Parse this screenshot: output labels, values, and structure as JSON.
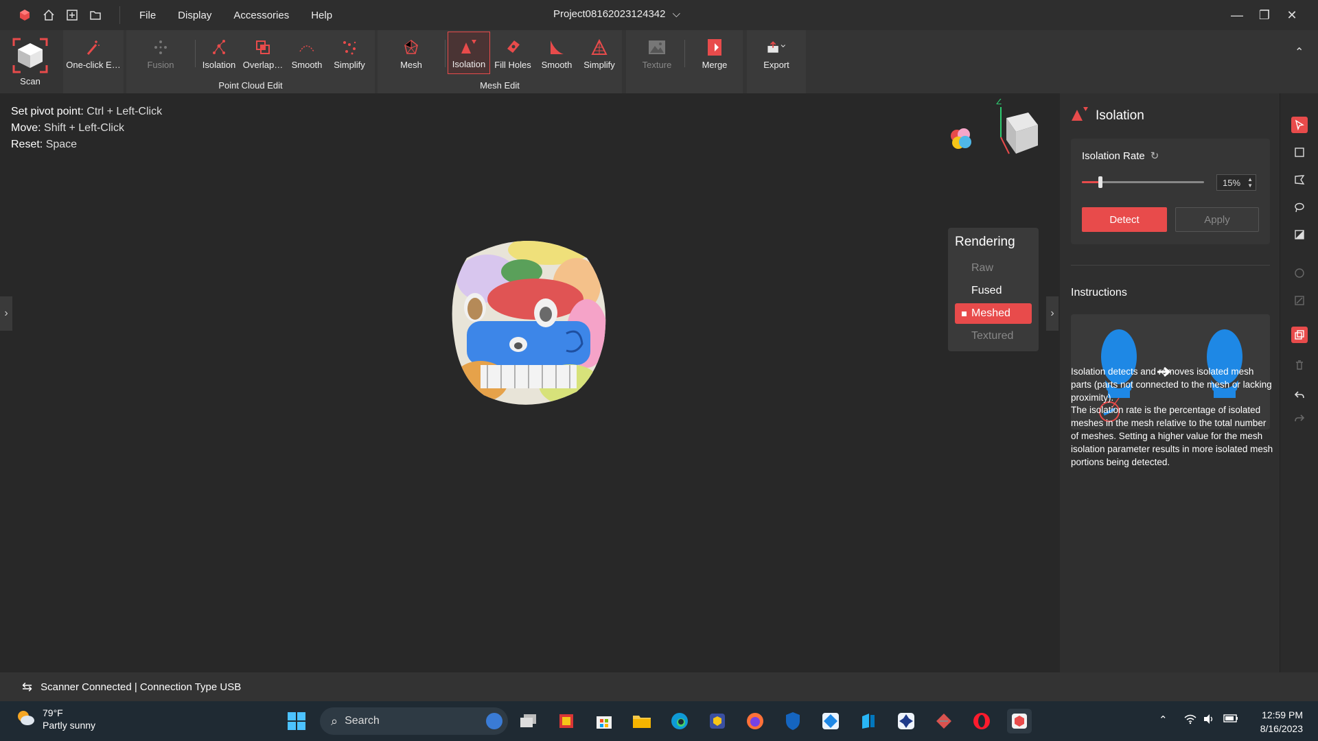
{
  "titlebar": {
    "menus": [
      "File",
      "Display",
      "Accessories",
      "Help"
    ],
    "project": "Project08162023124342"
  },
  "ribbon": {
    "scan": "Scan",
    "one_click": "One-click E…",
    "point_cloud_group": "Point Cloud Edit",
    "pc_fusion": "Fusion",
    "pc_isolation": "Isolation",
    "pc_overlap": "Overlap…",
    "pc_smooth": "Smooth",
    "pc_simplify": "Simplify",
    "mesh_group": "Mesh Edit",
    "mesh": "Mesh",
    "m_isolation": "Isolation",
    "m_fill_holes": "Fill Holes",
    "m_smooth": "Smooth",
    "m_simplify": "Simplify",
    "texture": "Texture",
    "merge": "Merge",
    "export": "Export"
  },
  "viewport": {
    "hints": [
      {
        "label": "Set pivot point:",
        "key": "Ctrl + Left-Click"
      },
      {
        "label": "Move:",
        "key": "Shift + Left-Click"
      },
      {
        "label": "Reset:",
        "key": "Space"
      }
    ],
    "rendering": {
      "title": "Rendering",
      "options": [
        "Raw",
        "Fused",
        "Meshed",
        "Textured"
      ],
      "selected": "Meshed"
    },
    "axis_label": "Z"
  },
  "panel": {
    "title": "Isolation",
    "rate_label": "Isolation Rate",
    "rate_value": "15%",
    "rate_fraction": 0.15,
    "detect": "Detect",
    "apply": "Apply",
    "instructions_title": "Instructions",
    "instr_1": "Isolation detects and removes isolated mesh parts (parts not connected to the mesh or lacking proximity).",
    "instr_2": "The isolation rate is the percentage of isolated meshes in the mesh relative to the total number of meshes. Setting a higher value for the mesh isolation parameter results in more isolated mesh portions being detected."
  },
  "status": {
    "text": "Scanner Connected | Connection Type USB"
  },
  "taskbar": {
    "temp": "79°F",
    "weather": "Partly sunny",
    "search": "Search",
    "time": "12:59 PM",
    "date": "8/16/2023"
  },
  "colors": {
    "accent": "#e84b4b",
    "background": "#282828",
    "panel": "#2f2f2f"
  }
}
